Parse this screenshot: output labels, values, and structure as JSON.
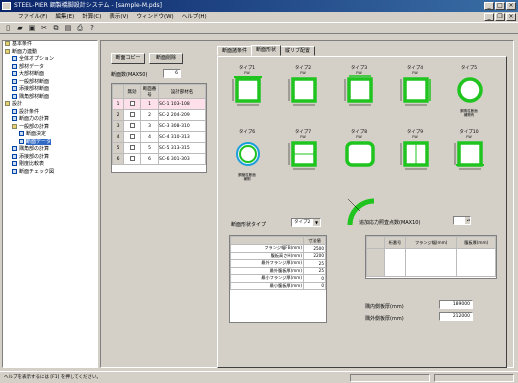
{
  "window": {
    "title": "STEEL-PIER 鋼製橋脚設計システム - [sample-M.pds]"
  },
  "menu": [
    "ファイル(F)",
    "編集(E)",
    "計算(C)",
    "表示(V)",
    "ウィンドウ(W)",
    "ヘルプ(H)"
  ],
  "toolbar": [
    "new-icon",
    "open-icon",
    "save-icon",
    "cut-icon",
    "copy-icon",
    "paste-icon",
    "print-icon",
    "help-icon"
  ],
  "tree": [
    {
      "label": "基本条件",
      "level": 0,
      "folder": true
    },
    {
      "label": "断面力連動",
      "level": 0,
      "folder": true
    },
    {
      "label": "全体オプション",
      "level": 1
    },
    {
      "label": "部材データ",
      "level": 1
    },
    {
      "label": "大部材断面",
      "level": 1
    },
    {
      "label": "一般部材断面",
      "level": 1
    },
    {
      "label": "添接部材断面",
      "level": 1
    },
    {
      "label": "隅角部材断面",
      "level": 1
    },
    {
      "label": "設計",
      "level": 0,
      "folder": true
    },
    {
      "label": "設計条件",
      "level": 1
    },
    {
      "label": "断面力の計算",
      "level": 1
    },
    {
      "label": "一般部の計算",
      "level": 1,
      "folder": true
    },
    {
      "label": "断面決定",
      "level": 2
    },
    {
      "label": "断面データ",
      "level": 2,
      "selected": true
    },
    {
      "label": "隅角部の計算",
      "level": 1
    },
    {
      "label": "添接部の計算",
      "level": 1
    },
    {
      "label": "剛度比較表",
      "level": 1
    },
    {
      "label": "断面チェック図",
      "level": 1
    }
  ],
  "left_buttons": {
    "copy": "断面コピー",
    "delete": "断面削除"
  },
  "count": {
    "label": "断面数(MAX50)",
    "value": "6"
  },
  "grid": {
    "headers": [
      "",
      "無効",
      "断面番号",
      "設計部材名"
    ],
    "rows": [
      {
        "idx": "1",
        "num": "1",
        "name": "SC-1 103-108",
        "selected": true
      },
      {
        "idx": "2",
        "num": "2",
        "name": "SC-2 204-209"
      },
      {
        "idx": "3",
        "num": "3",
        "name": "SC-3 308-310"
      },
      {
        "idx": "4",
        "num": "4",
        "name": "SC-4 310-313"
      },
      {
        "idx": "5",
        "num": "5",
        "name": "SC-5 313-315"
      },
      {
        "idx": "6",
        "num": "6",
        "name": "SC-6 301-303"
      }
    ]
  },
  "tabs": [
    "断面諸条件",
    "断面形状",
    "縦リブ配置"
  ],
  "active_tab": 1,
  "shapes": [
    {
      "label": "タイプ1",
      "sub": "FW"
    },
    {
      "label": "タイプ2",
      "sub": "FW"
    },
    {
      "label": "タイプ3",
      "sub": "FW"
    },
    {
      "label": "タイプ4",
      "sub": "FW"
    },
    {
      "label": "タイプ5",
      "sub": "",
      "note": "鋼角柱断面\n補剛有"
    },
    {
      "label": "タイプ6",
      "sub": "",
      "note": "鋼管柱断面\n補剛"
    },
    {
      "label": "タイプ7",
      "sub": "FW"
    },
    {
      "label": "タイプ8",
      "sub": "FW"
    },
    {
      "label": "タイプ9",
      "sub": "FW"
    },
    {
      "label": "タイプ10",
      "sub": "FW"
    }
  ],
  "shape_type": {
    "label": "断面形状タイプ",
    "value": "タイプ2"
  },
  "props": {
    "header": "寸法値",
    "rows": [
      {
        "name": "フランジ幅FB(mm)",
        "value": "2500"
      },
      {
        "name": "腹板高さH(mm)",
        "value": "2200"
      },
      {
        "name": "最外フランジ厚(mm)",
        "value": "25"
      },
      {
        "name": "最外腹板厚(mm)",
        "value": "25"
      },
      {
        "name": "最小フランジ厚(mm)",
        "value": "0"
      },
      {
        "name": "最小腹板厚(mm)",
        "value": "0"
      }
    ]
  },
  "stress_points": {
    "label": "追加応力照査点数(MAX10)",
    "value": "0"
  },
  "rgrid_headers": [
    "",
    "桁番号",
    "フランジ幅(mm)",
    "腹板厚(mm)"
  ],
  "corner": {
    "inner_label": "隅内側板厚(mm)",
    "inner_value": "189000",
    "outer_label": "隅外側板厚(mm)",
    "outer_value": "212000"
  },
  "status": "ヘルプを表示するには [F1] を押してください。"
}
